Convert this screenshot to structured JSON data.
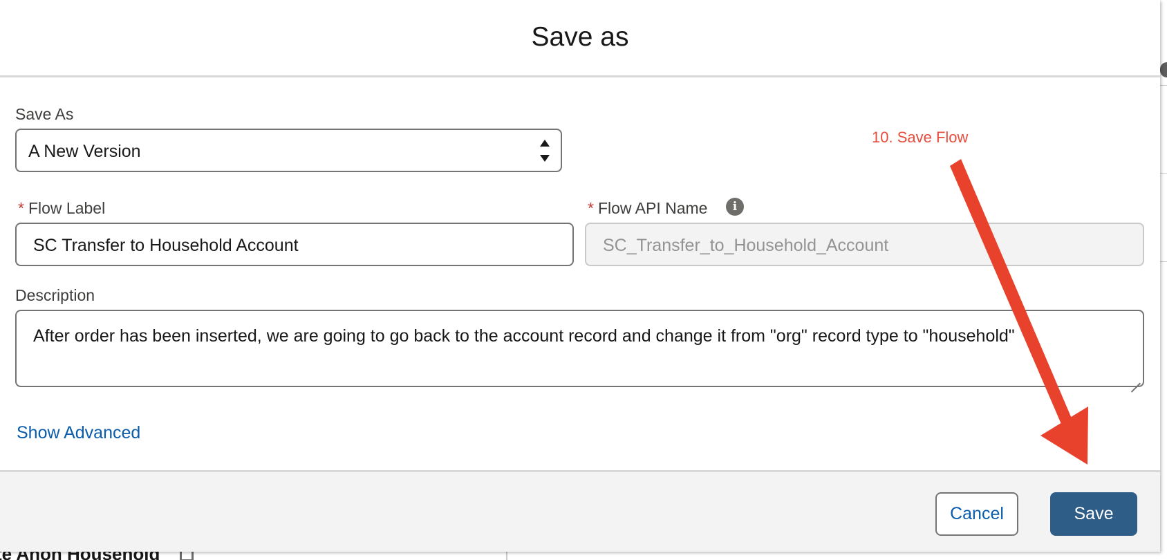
{
  "modal": {
    "title": "Save as"
  },
  "form": {
    "save_as": {
      "label": "Save As",
      "selected": "A New Version"
    },
    "flow_label": {
      "required_marker": "*",
      "label": "Flow Label",
      "value": "SC Transfer to Household Account"
    },
    "flow_api_name": {
      "required_marker": "*",
      "label": "Flow API Name",
      "value": "SC_Transfer_to_Household_Account",
      "info_icon": "info-icon"
    },
    "description": {
      "label": "Description",
      "value": "After order has been inserted, we are going to go back to the account record and change it from \"org\" record type to \"household\""
    },
    "show_advanced": "Show Advanced"
  },
  "footer": {
    "cancel_label": "Cancel",
    "save_label": "Save"
  },
  "annotation": {
    "text": "10. Save Flow",
    "color": "#e74c3c"
  },
  "background": {
    "partial_text": "te Anon Household"
  },
  "colors": {
    "brand": "#2e5d88",
    "link": "#0b5cab",
    "required": "#c23934"
  }
}
